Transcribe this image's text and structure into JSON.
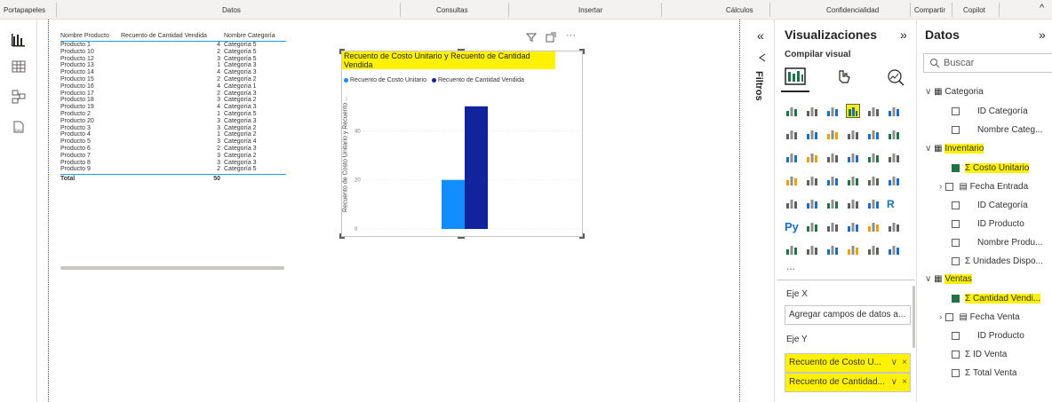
{
  "ribbon": {
    "portapapeles": "Portapapeles",
    "datos": "Datos",
    "consultas": "Consultas",
    "insertar": "Insertar",
    "calculos": "Cálculos",
    "confidencialidad": "Confidencialidad",
    "compartir": "Compartir",
    "copilot": "Copilot",
    "collapse": "^"
  },
  "table": {
    "headers": [
      "Nombre Producto",
      "Recuento de Cantidad Vendida",
      "Nombre Categoría"
    ],
    "rows": [
      [
        "Producto 1",
        "4",
        "Categoría 5"
      ],
      [
        "Producto 10",
        "2",
        "Categoría 5"
      ],
      [
        "Producto 12",
        "3",
        "Categoría 5"
      ],
      [
        "Producto 13",
        "1",
        "Categoría 3"
      ],
      [
        "Producto 14",
        "4",
        "Categoría 3"
      ],
      [
        "Producto 15",
        "2",
        "Categoría 2"
      ],
      [
        "Producto 16",
        "4",
        "Categoría 1"
      ],
      [
        "Producto 17",
        "2",
        "Categoría 3"
      ],
      [
        "Producto 18",
        "3",
        "Categoría 2"
      ],
      [
        "Producto 19",
        "4",
        "Categoría 3"
      ],
      [
        "Producto 2",
        "1",
        "Categoría 5"
      ],
      [
        "Producto 20",
        "3",
        "Categoría 3"
      ],
      [
        "Producto 3",
        "3",
        "Categoría 2"
      ],
      [
        "Producto 4",
        "1",
        "Categoría 2"
      ],
      [
        "Producto 5",
        "3",
        "Categoría 4"
      ],
      [
        "Producto 6",
        "2",
        "Categoría 3"
      ],
      [
        "Producto 7",
        "3",
        "Categoría 2"
      ],
      [
        "Producto 8",
        "3",
        "Categoría 3"
      ],
      [
        "Producto 9",
        "2",
        "Categoría 5"
      ]
    ],
    "total_label": "Total",
    "total_value": "50"
  },
  "chart_data": {
    "type": "bar",
    "title": "Recuento de Costo Unitario y Recuento de Cantidad Vendida",
    "ylabel": "Recuento de Costo Unitario y Recuento ...",
    "categories": [
      ""
    ],
    "series": [
      {
        "name": "Recuento de Costo Unitario",
        "values": [
          20
        ],
        "color": "#118dff"
      },
      {
        "name": "Recuento de Cantidad Vendida",
        "values": [
          50
        ],
        "color": "#12239e"
      }
    ],
    "yticks": [
      "0",
      "20",
      "40"
    ],
    "ylim": [
      0,
      55
    ],
    "grid": true,
    "legend_position": "top-left"
  },
  "visual_header": {
    "filter_icon": "filter-icon",
    "focus_icon": "focus-mode-icon",
    "more": "···"
  },
  "filters_pane": {
    "collapse": "«",
    "label": "Filtros"
  },
  "viz_pane": {
    "title": "Visualizaciones",
    "expand": "»",
    "subtitle": "Compilar visual",
    "more": "...",
    "eje_x": "Eje X",
    "eje_x_placeholder": "Agregar campos de datos a...",
    "eje_y": "Eje Y",
    "y_fields": [
      "Recuento de Costo U...",
      "Recuento de Cantidad..."
    ],
    "icon_py": "Py",
    "icon_r": "R"
  },
  "datos_pane": {
    "title": "Datos",
    "expand": "»",
    "search_placeholder": "Buscar",
    "tables": [
      {
        "name": "Categoria",
        "fields": [
          "ID Categoría",
          "Nombre Categ..."
        ]
      },
      {
        "name": "Inventario",
        "fields": [
          "Σ Costo Unitario",
          "Fecha Entrada",
          "ID Categoría",
          "ID Producto",
          "Nombre Produ...",
          "Σ Unidades Dispo..."
        ]
      },
      {
        "name": "Ventas",
        "fields": [
          "Σ Cantidad Vendi...",
          "Fecha Venta",
          "ID Producto",
          "Σ ID Venta",
          "Σ Total Venta"
        ]
      }
    ]
  }
}
